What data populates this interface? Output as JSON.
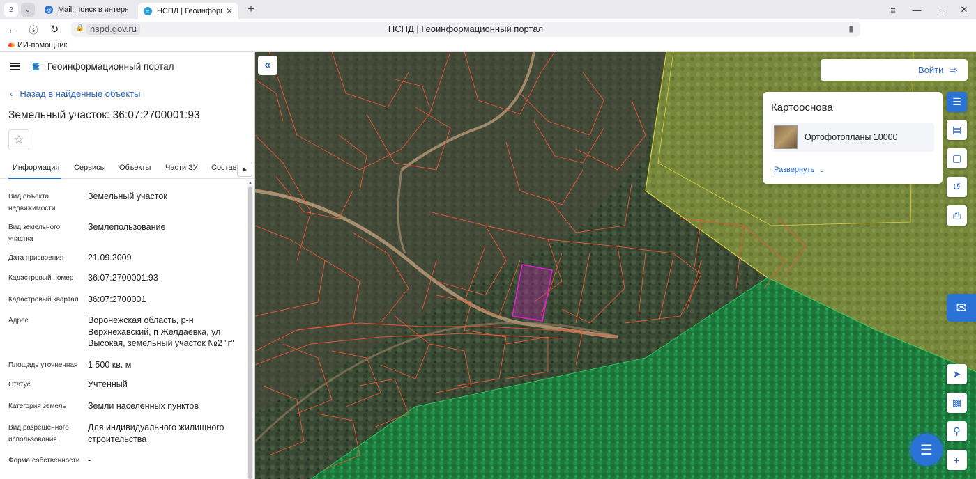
{
  "browser": {
    "tab_counter": "2",
    "tabs": [
      {
        "title": "Mail: поиск в интернете",
        "active": false
      },
      {
        "title": "НСПД | Геоинформацио",
        "active": true
      }
    ],
    "url_domain": "nspd.gov.ru",
    "page_title": "НСПД | Геоинформационный портал",
    "bookmark": "ИИ-помощник"
  },
  "panel": {
    "portal_name": "Геоинформационный портал",
    "back_link": "Назад в найденные объекты",
    "object_title": "Земельный участок: 36:07:2700001:93",
    "tabs": [
      "Информация",
      "Сервисы",
      "Объекты",
      "Части ЗУ",
      "Состав"
    ],
    "rows": [
      {
        "label": "Вид объекта недвижимости",
        "value": "Земельный участок"
      },
      {
        "label": "Вид земельного участка",
        "value": "Землепользование"
      },
      {
        "label": "Дата присвоения",
        "value": "21.09.2009"
      },
      {
        "label": "Кадастровый номер",
        "value": "36:07:2700001:93"
      },
      {
        "label": "Кадастровый квартал",
        "value": "36:07:2700001"
      },
      {
        "label": "Адрес",
        "value": "Воронежская область, р-н Верхнехавский, п Желдаевка, ул Высокая, земельный участок №2 \"г\""
      },
      {
        "label": "Площадь уточненная",
        "value": "1 500 кв. м"
      },
      {
        "label": "Статус",
        "value": "Учтенный"
      },
      {
        "label": "Категория земель",
        "value": "Земли населенных пунктов"
      },
      {
        "label": "Вид разрешенного использования",
        "value": "Для индивидуального жилищного строительства"
      },
      {
        "label": "Форма собственности",
        "value": "-"
      }
    ]
  },
  "map": {
    "login_label": "Войти",
    "basemap": {
      "title": "Картооснова",
      "item": "Ортофотопланы 10000",
      "expand": "Развернуть"
    },
    "colors": {
      "parcel_outline": "#e8553a",
      "selected_parcel": "#d020c0",
      "forest_zone": "#1fa04a",
      "yellow_zone": "#e0d040",
      "accent": "#2a72d6"
    }
  }
}
